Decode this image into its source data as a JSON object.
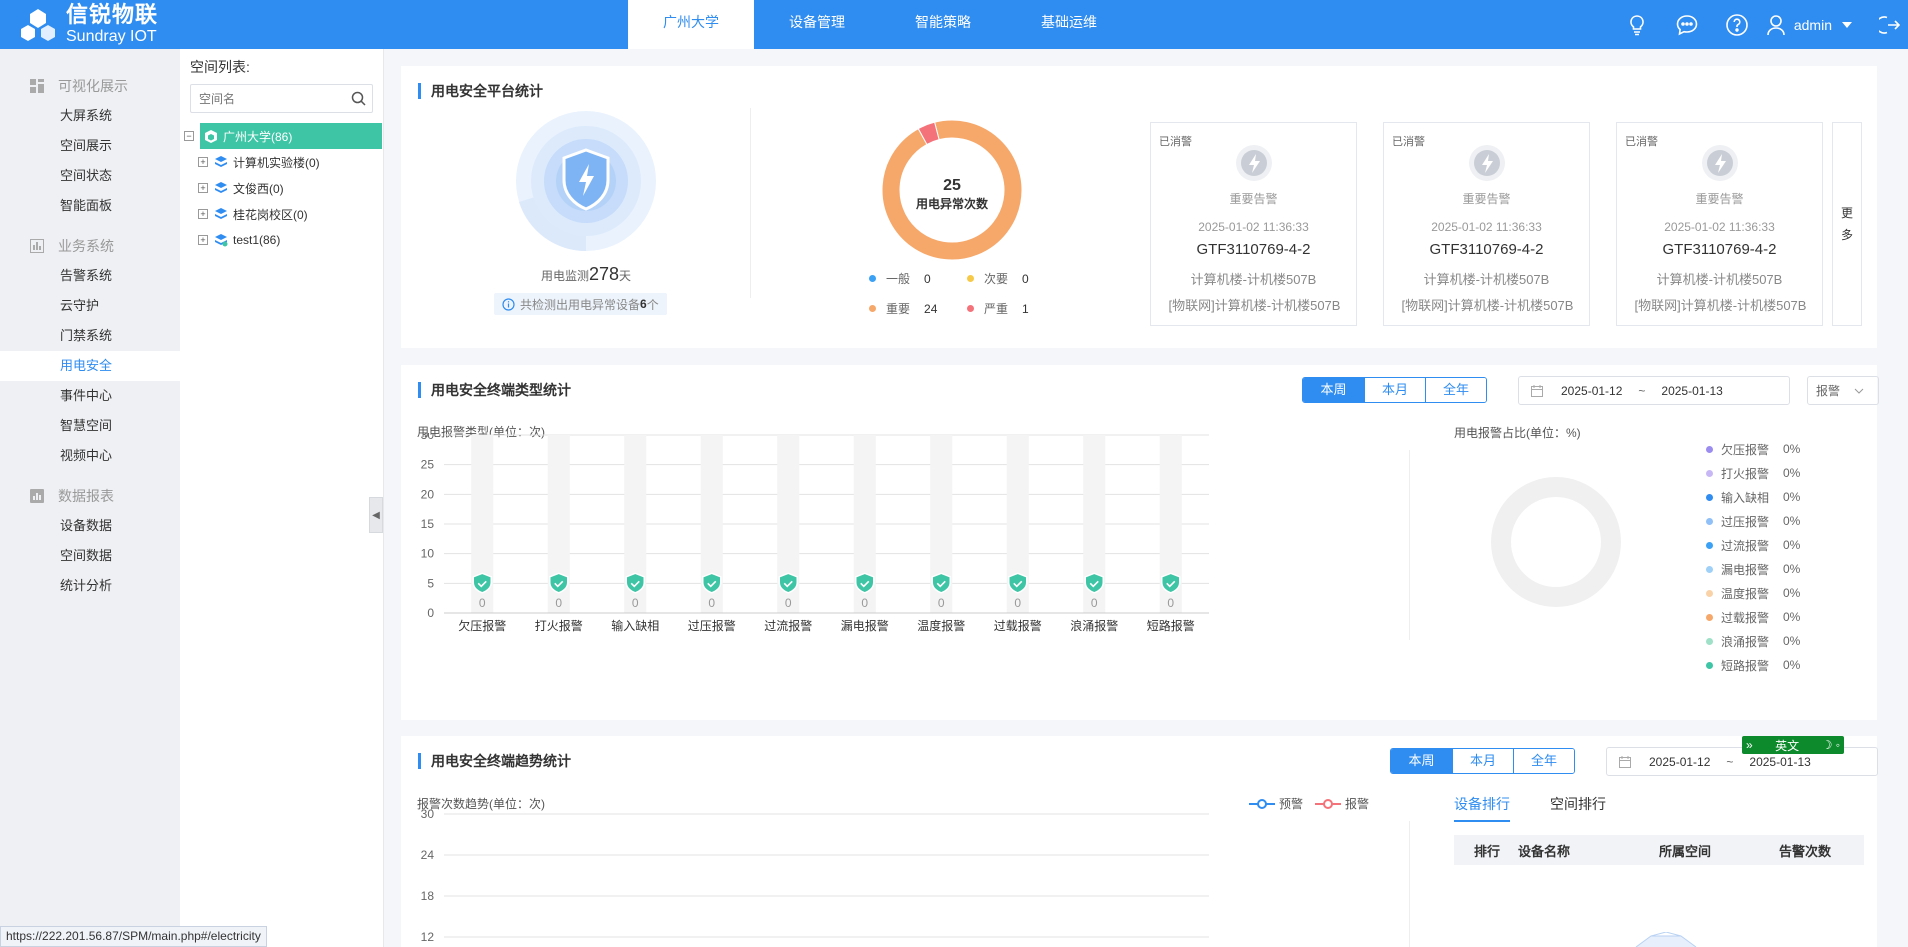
{
  "brand": {
    "name_cn": "信锐物联",
    "name_en": "Sundray IOT"
  },
  "nav": {
    "tabs": [
      {
        "label": "广州大学",
        "active": true
      },
      {
        "label": "设备管理",
        "active": false
      },
      {
        "label": "智能策略",
        "active": false
      },
      {
        "label": "基础运维",
        "active": false
      }
    ]
  },
  "topbar": {
    "user": "admin",
    "icons": [
      "bulb-icon",
      "chat-icon",
      "help-icon",
      "user-icon",
      "logout-icon"
    ]
  },
  "sidebar": {
    "groups": [
      {
        "label": "可视化展示",
        "icon": "dashboard-icon",
        "items": [
          "大屏系统",
          "空间展示",
          "空间状态",
          "智能面板"
        ]
      },
      {
        "label": "业务系统",
        "icon": "business-icon",
        "items": [
          "告警系统",
          "云守护",
          "门禁系统",
          "用电安全",
          "事件中心",
          "智慧空间",
          "视频中心"
        ]
      },
      {
        "label": "数据报表",
        "icon": "report-icon",
        "items": [
          "设备数据",
          "空间数据",
          "统计分析"
        ]
      }
    ],
    "active_item": "用电安全"
  },
  "space_list": {
    "title": "空间列表:",
    "search_placeholder": "空间名",
    "root": "广州大学(86)",
    "children": [
      "计算机实验楼(0)",
      "文俊西(0)",
      "桂花岗校区(0)",
      "test1(86)"
    ]
  },
  "stats": {
    "title": "用电安全平台统计",
    "monitor_label": "用电监测",
    "monitor_days": "278",
    "monitor_unit": "天",
    "detect_prefix": "共检测出用电异常设备",
    "detect_count": "6",
    "detect_suffix": "个",
    "donut_total": "25",
    "donut_label": "用电异常次数",
    "levels": [
      {
        "name": "一般",
        "value": 0,
        "color": "#3ba1f5"
      },
      {
        "name": "次要",
        "value": 0,
        "color": "#f7c948"
      },
      {
        "name": "重要",
        "value": 24,
        "color": "#f6a86a"
      },
      {
        "name": "严重",
        "value": 1,
        "color": "#f4737a"
      }
    ],
    "alerts": [
      {
        "tag": "已消警",
        "level": "重要告警",
        "time": "2025-01-02 11:36:33",
        "device": "GTF3110769-4-2",
        "location": "计算机楼-计机楼507B",
        "network": "[物联网]计算机楼-计机楼507B"
      },
      {
        "tag": "已消警",
        "level": "重要告警",
        "time": "2025-01-02 11:36:33",
        "device": "GTF3110769-4-2",
        "location": "计算机楼-计机楼507B",
        "network": "[物联网]计算机楼-计机楼507B"
      },
      {
        "tag": "已消警",
        "level": "重要告警",
        "time": "2025-01-02 11:36:33",
        "device": "GTF3110769-4-2",
        "location": "计算机楼-计机楼507B",
        "network": "[物联网]计算机楼-计机楼507B"
      }
    ],
    "more": [
      "更",
      "多"
    ]
  },
  "types": {
    "title": "用电安全终端类型统计",
    "periods": [
      "本周",
      "本月",
      "全年"
    ],
    "active_period": "本周",
    "date_start": "2025-01-12",
    "date_sep": "~",
    "date_end": "2025-01-13",
    "type_select": "报警",
    "bar_title": "用电报警类型(单位：次)",
    "pie_title": "用电报警占比(单位：%)"
  },
  "chart_data": [
    {
      "type": "bar",
      "title": "用电报警类型(单位：次)",
      "categories": [
        "欠压报警",
        "打火报警",
        "输入缺相",
        "过压报警",
        "过流报警",
        "漏电报警",
        "温度报警",
        "过载报警",
        "浪涌报警",
        "短路报警"
      ],
      "values": [
        0,
        0,
        0,
        0,
        0,
        0,
        0,
        0,
        0,
        0
      ],
      "ylim": [
        0,
        30
      ],
      "yticks": [
        0,
        5,
        10,
        15,
        20,
        25,
        30
      ]
    },
    {
      "type": "pie",
      "title": "用电报警占比(单位：%)",
      "categories": [
        "欠压报警",
        "打火报警",
        "输入缺相",
        "过压报警",
        "过流报警",
        "漏电报警",
        "温度报警",
        "过载报警",
        "浪涌报警",
        "短路报警"
      ],
      "values": [
        0,
        0,
        0,
        0,
        0,
        0,
        0,
        0,
        0,
        0
      ],
      "value_labels": [
        "0%",
        "0%",
        "0%",
        "0%",
        "0%",
        "0%",
        "0%",
        "0%",
        "0%",
        "0%"
      ],
      "colors": [
        "#9b8cf0",
        "#c7b8f5",
        "#2f8cf0",
        "#8fc0f7",
        "#3ba1f5",
        "#9fd0f7",
        "#f9d2a8",
        "#f6a86a",
        "#9ee0c8",
        "#3ec5a5"
      ]
    },
    {
      "type": "line",
      "title": "报警次数趋势(单位：次)",
      "series": [
        {
          "name": "预警",
          "values": []
        },
        {
          "name": "报警",
          "values": []
        }
      ],
      "ylim": [
        12,
        30
      ],
      "yticks": [
        30,
        24,
        18,
        12
      ]
    }
  ],
  "trend": {
    "title": "用电安全终端趋势统计",
    "periods": [
      "本周",
      "本月",
      "全年"
    ],
    "active_period": "本周",
    "date_start": "2025-01-12",
    "date_sep": "~",
    "date_end": "2025-01-13",
    "line_title": "报警次数趋势(单位：次)",
    "legend": [
      {
        "name": "预警",
        "color": "#2f8cf0"
      },
      {
        "name": "报警",
        "color": "#f4737a"
      }
    ],
    "rank_tabs": [
      "设备排行",
      "空间排行"
    ],
    "rank_columns": [
      "排行",
      "设备名称",
      "所属空间",
      "告警次数"
    ]
  },
  "ime": {
    "label": "英文"
  },
  "status_url": "https://222.201.56.87/SPM/main.php#/electricity",
  "colors": {
    "primary": "#2f8cf0",
    "teal": "#3ec5a5",
    "orange": "#f6a86a",
    "red": "#f4737a"
  }
}
